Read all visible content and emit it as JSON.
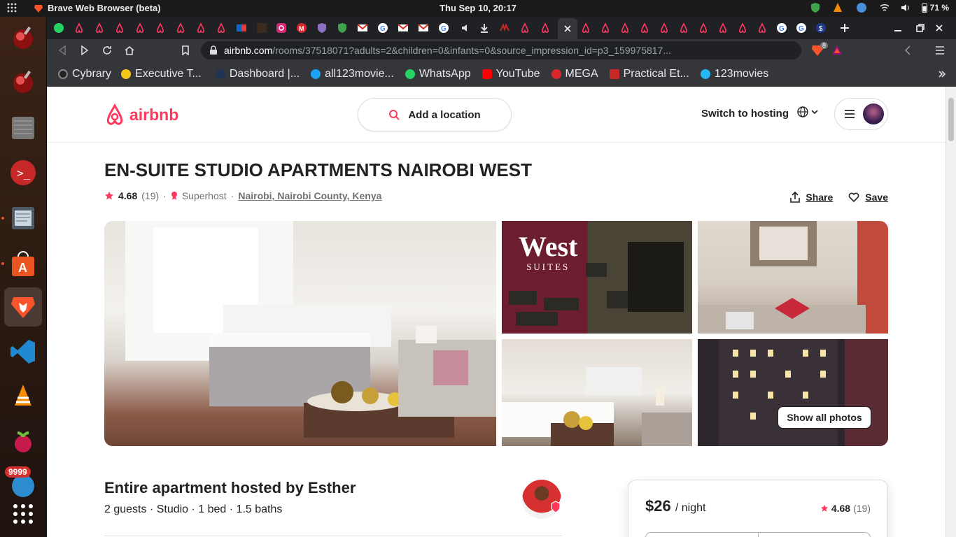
{
  "system": {
    "app_title": "Brave Web Browser (beta)",
    "clock": "Thu Sep 10, 20:17",
    "battery": "71 %",
    "dock_badge": "9999"
  },
  "browser": {
    "url_host": "airbnb.com",
    "url_rest": "/rooms/37518071?adults=2&children=0&infants=0&source_impression_id=p3_159975817...",
    "shields_count": "8",
    "bookmarks": [
      {
        "label": "Cybrary",
        "color": "#222222"
      },
      {
        "label": "Executive T...",
        "color": "#f5c518"
      },
      {
        "label": "Dashboard |...",
        "color": "#223355"
      },
      {
        "label": "all123movie...",
        "color": "#1da1f2"
      },
      {
        "label": "WhatsApp",
        "color": "#25d366"
      },
      {
        "label": "YouTube",
        "color": "#ff0000"
      },
      {
        "label": "MEGA",
        "color": "#d9272e"
      },
      {
        "label": "Practical Et...",
        "color": "#c62828"
      },
      {
        "label": "123movies",
        "color": "#29b6f6"
      }
    ]
  },
  "site": {
    "logo_text": "airbnb",
    "search_label": "Add a location",
    "switch_hosting": "Switch to hosting",
    "brand_color": "#FF385C"
  },
  "listing": {
    "title": "EN-SUITE STUDIO APARTMENTS NAIROBI WEST",
    "rating": "4.68",
    "reviews": "(19)",
    "superhost": "Superhost",
    "location": "Nairobi, Nairobi County, Kenya",
    "share": "Share",
    "save": "Save",
    "show_all_photos": "Show all photos",
    "sign_word": "West",
    "sign_sub": "SUITES",
    "host_line": "Entire apartment hosted by Esther",
    "specs": "2 guests · Studio · 1 bed · 1.5 baths",
    "price": "$26",
    "per_night": "/ night"
  }
}
